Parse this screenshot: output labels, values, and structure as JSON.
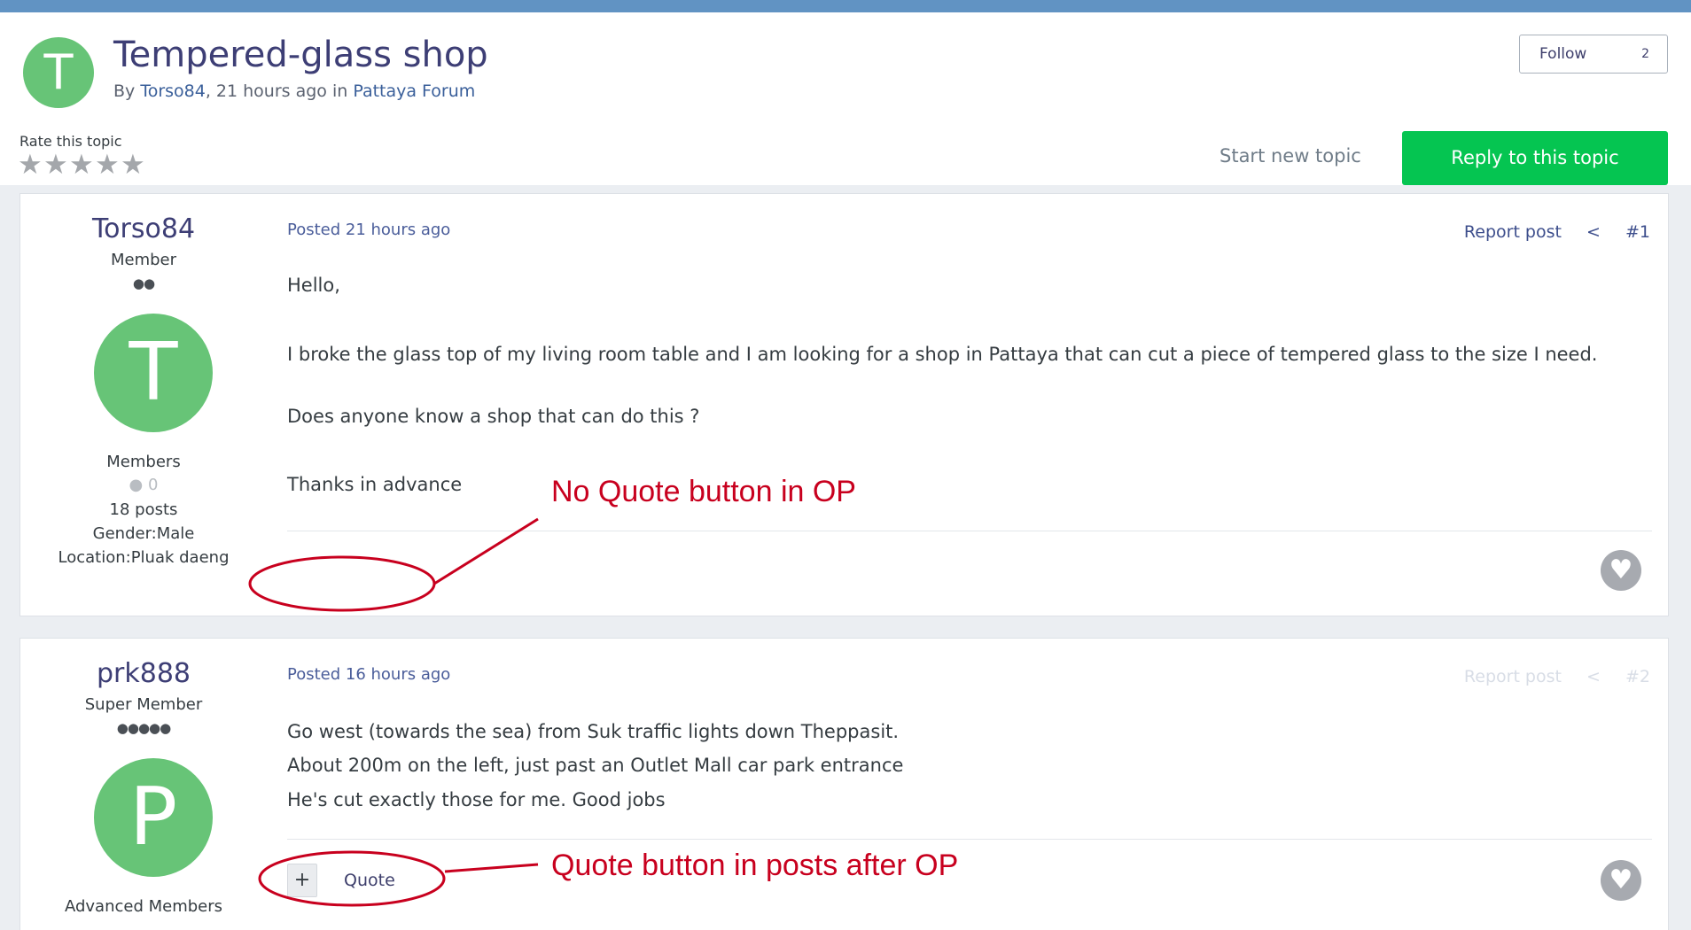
{
  "topic": {
    "avatar_letter": "T",
    "title": "Tempered-glass shop",
    "by_prefix": "By",
    "author": "Torso84",
    "when": ", 21 hours ago in",
    "forum": "Pattaya Forum"
  },
  "follow": {
    "label": "Follow",
    "count": "2"
  },
  "rating": {
    "label": "Rate this topic",
    "stars": 5,
    "value": 0
  },
  "actions": {
    "start_new_topic": "Start new topic",
    "reply": "Reply to this topic"
  },
  "posts": [
    {
      "author": "Torso84",
      "rank": "Member",
      "pips": "●●",
      "avatar_letter": "T",
      "group": "Members",
      "reputation": "0",
      "post_count": "18 posts",
      "gender": "Gender:Male",
      "location": "Location:Pluak daeng",
      "posted": "Posted 21 hours ago",
      "report": "Report post",
      "number": "#1",
      "lines": [
        "Hello,",
        "I broke the glass top of my living room table and I am looking for a shop in Pattaya that can cut a piece of tempered glass to the size I need.",
        "Does anyone know a shop that can do this ?",
        "Thanks in advance"
      ]
    },
    {
      "author": "prk888",
      "rank": "Super Member",
      "pips": "●●●●●",
      "avatar_letter": "P",
      "group": "Advanced Members",
      "posted": "Posted 16 hours ago",
      "report": "Report post",
      "number": "#2",
      "quote_label": "Quote",
      "lines": [
        "Go west (towards the sea) from Suk traffic lights down Theppasit.",
        "About 200m on the left, just past an Outlet Mall car park entrance",
        "He's cut exactly those for me.  Good jobs"
      ]
    }
  ],
  "annotations": {
    "op": "No Quote button in OP",
    "after": "Quote button in posts after OP",
    "color": "#c8001e"
  },
  "icons": {
    "share": "share-icon",
    "like": "heart-icon",
    "star": "star-icon",
    "reputation": "reputation-dot-icon"
  }
}
